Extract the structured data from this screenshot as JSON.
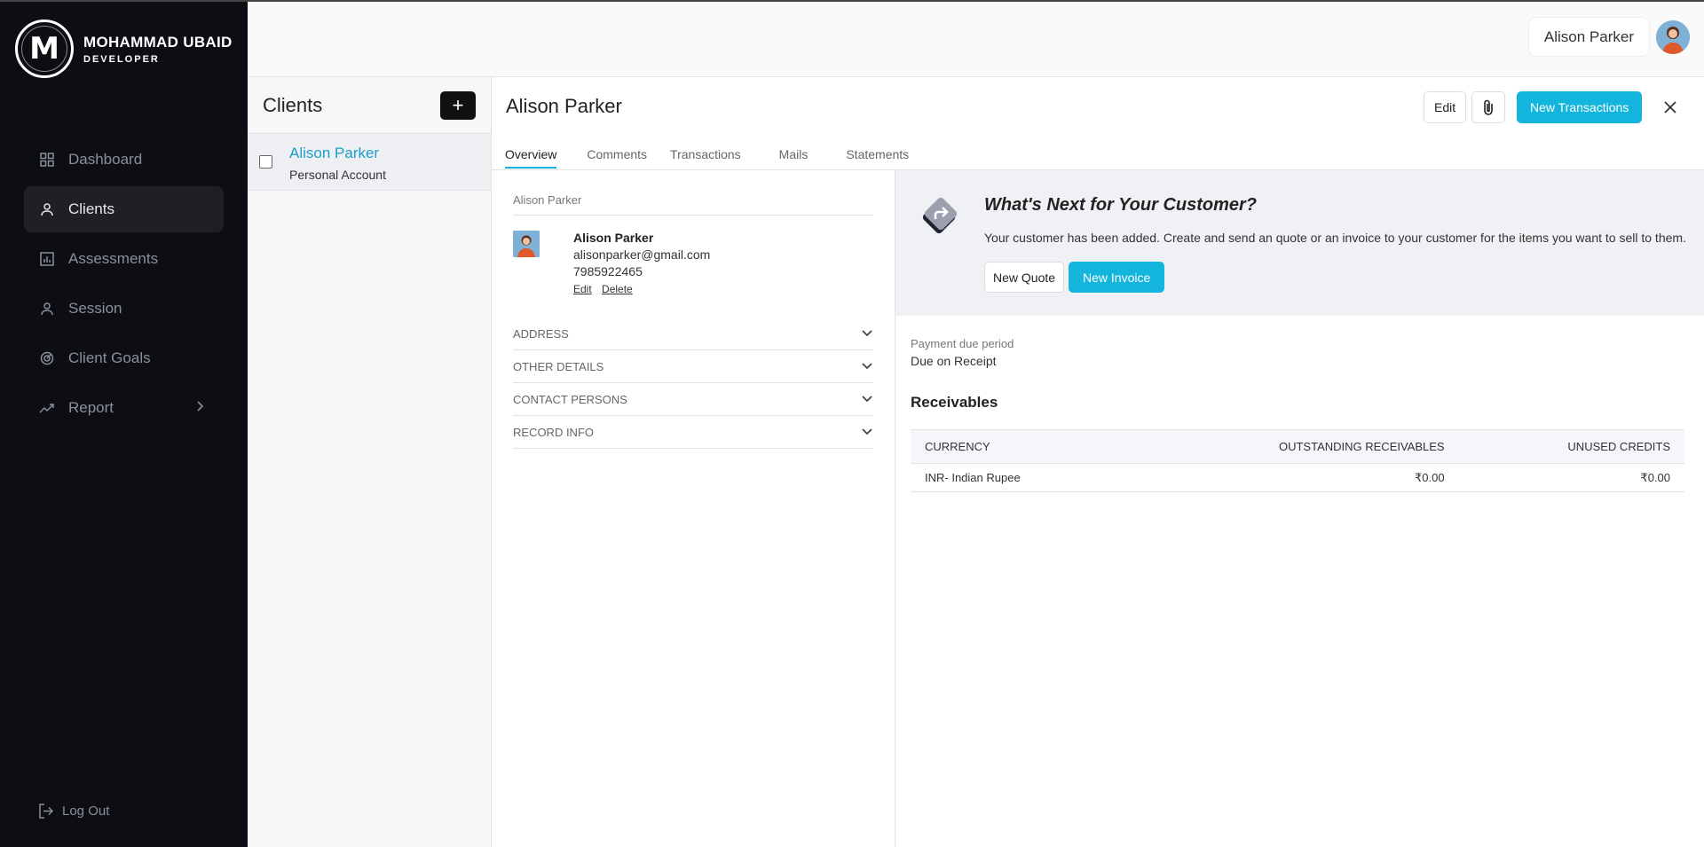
{
  "brand": {
    "logo_letter": "M",
    "name": "MOHAMMAD UBAID",
    "role": "DEVELOPER"
  },
  "nav": {
    "items": [
      {
        "label": "Dashboard",
        "icon": "grid-icon"
      },
      {
        "label": "Clients",
        "icon": "user-icon",
        "active": true
      },
      {
        "label": "Assessments",
        "icon": "bar-chart-icon"
      },
      {
        "label": "Session",
        "icon": "user-icon"
      },
      {
        "label": "Client Goals",
        "icon": "goal-icon"
      },
      {
        "label": "Report",
        "icon": "trend-icon",
        "has_submenu": true
      }
    ],
    "logout": "Log Out"
  },
  "topbar": {
    "user_name": "Alison Parker"
  },
  "clients": {
    "title": "Clients",
    "add_label": "+",
    "list": [
      {
        "name": "Alison Parker",
        "type": "Personal Account"
      }
    ]
  },
  "detail": {
    "title": "Alison Parker",
    "edit_label": "Edit",
    "new_transactions_label": "New Transactions",
    "tabs": [
      "Overview",
      "Comments",
      "Transactions",
      "Mails",
      "Statements"
    ],
    "active_tab": "Overview"
  },
  "profile": {
    "heading": "Alison Parker",
    "name": "Alison Parker",
    "email": "alisonparker@gmail.com",
    "phone": "7985922465",
    "edit_link": "Edit",
    "delete_link": "Delete",
    "sections": [
      "ADDRESS",
      "OTHER DETAILS",
      "CONTACT PERSONS",
      "RECORD INFO"
    ]
  },
  "next": {
    "title": "What's Next for Your Customer?",
    "text": "Your customer has been added. Create and send an quote or an invoice to your customer for the items you want to sell to them.",
    "quote_label": "New Quote",
    "invoice_label": "New Invoice"
  },
  "payment": {
    "label": "Payment due period",
    "value": "Due on Receipt"
  },
  "receivables": {
    "title": "Receivables",
    "columns": [
      "CURRENCY",
      "OUTSTANDING RECEIVABLES",
      "UNUSED CREDITS"
    ],
    "rows": [
      [
        "INR- Indian Rupee",
        "₹0.00",
        "₹0.00"
      ]
    ]
  },
  "colors": {
    "accent": "#14b5dd",
    "sidebar_bg": "#0c0e14",
    "link": "#1aa0c8"
  }
}
